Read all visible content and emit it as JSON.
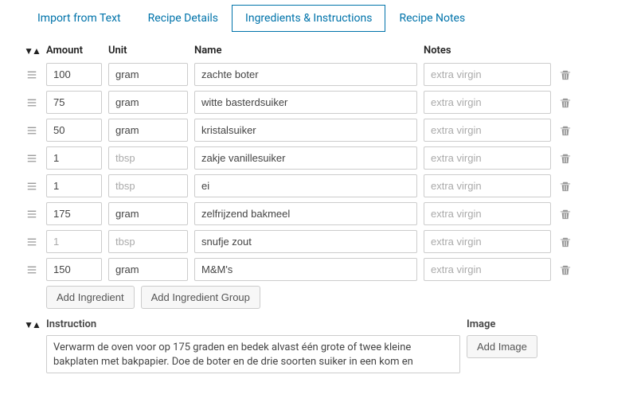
{
  "tabs": [
    {
      "label": "Import from Text",
      "active": false
    },
    {
      "label": "Recipe Details",
      "active": false
    },
    {
      "label": "Ingredients & Instructions",
      "active": true
    },
    {
      "label": "Recipe Notes",
      "active": false
    }
  ],
  "ingredients": {
    "headers": {
      "amount": "Amount",
      "unit": "Unit",
      "name": "Name",
      "notes": "Notes"
    },
    "placeholders": {
      "amount": "1",
      "unit": "tbsp",
      "notes": "extra virgin"
    },
    "rows": [
      {
        "amount": "100",
        "unit": "gram",
        "name": "zachte boter",
        "notes": ""
      },
      {
        "amount": "75",
        "unit": "gram",
        "name": "witte basterdsuiker",
        "notes": ""
      },
      {
        "amount": "50",
        "unit": "gram",
        "name": "kristalsuiker",
        "notes": ""
      },
      {
        "amount": "1",
        "unit": "",
        "name": "zakje vanillesuiker",
        "notes": ""
      },
      {
        "amount": "1",
        "unit": "",
        "name": "ei",
        "notes": ""
      },
      {
        "amount": "175",
        "unit": "gram",
        "name": "zelfrijzend bakmeel",
        "notes": ""
      },
      {
        "amount": "",
        "unit": "",
        "name": "snufje zout",
        "notes": ""
      },
      {
        "amount": "150",
        "unit": "gram",
        "name": "M&M's",
        "notes": ""
      }
    ],
    "buttons": {
      "add_ingredient": "Add Ingredient",
      "add_group": "Add Ingredient Group"
    }
  },
  "instructions": {
    "headers": {
      "instruction": "Instruction",
      "image": "Image"
    },
    "rows": [
      {
        "text": "Verwarm de oven voor op 175 graden en bedek alvast één grote of twee kleine bakplaten met bakpapier. Doe de boter en de drie soorten suiker in een kom en"
      }
    ],
    "buttons": {
      "add_image": "Add Image"
    }
  }
}
